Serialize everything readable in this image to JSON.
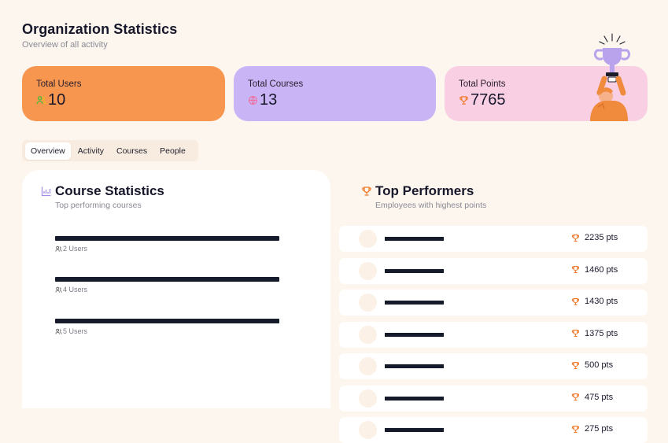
{
  "header": {
    "title": "Organization Statistics",
    "subtitle": "Overview of all activity"
  },
  "stats": {
    "users": {
      "label": "Total Users",
      "value": "10",
      "icon": "users-icon",
      "color": "#f7964e"
    },
    "courses": {
      "label": "Total Courses",
      "value": "13",
      "icon": "globe-icon",
      "color": "#c9b5f5"
    },
    "points": {
      "label": "Total Points",
      "value": "7765",
      "icon": "trophy-icon",
      "color": "#f9cfe3"
    }
  },
  "tabs": [
    {
      "label": "Overview",
      "active": true
    },
    {
      "label": "Activity",
      "active": false
    },
    {
      "label": "Courses",
      "active": false
    },
    {
      "label": "People",
      "active": false
    }
  ],
  "course_statistics": {
    "title": "Course Statistics",
    "subtitle": "Top performing courses",
    "icon": "bar-chart-icon",
    "courses": [
      {
        "users": "2 Users"
      },
      {
        "users": "4 Users"
      },
      {
        "users": "5 Users"
      }
    ]
  },
  "top_performers": {
    "title": "Top Performers",
    "subtitle": "Employees with highest points",
    "icon": "trophy-icon",
    "rows": [
      {
        "points": "2235 pts"
      },
      {
        "points": "1460 pts"
      },
      {
        "points": "1430 pts"
      },
      {
        "points": "1375 pts"
      },
      {
        "points": "500 pts"
      },
      {
        "points": "475 pts"
      },
      {
        "points": "275 pts"
      }
    ]
  },
  "colors": {
    "background": "#fdf6ef",
    "accent_orange": "#f7964e",
    "accent_purple": "#c9b5f5",
    "accent_pink": "#f9cfe3",
    "bar": "#151b2a"
  }
}
